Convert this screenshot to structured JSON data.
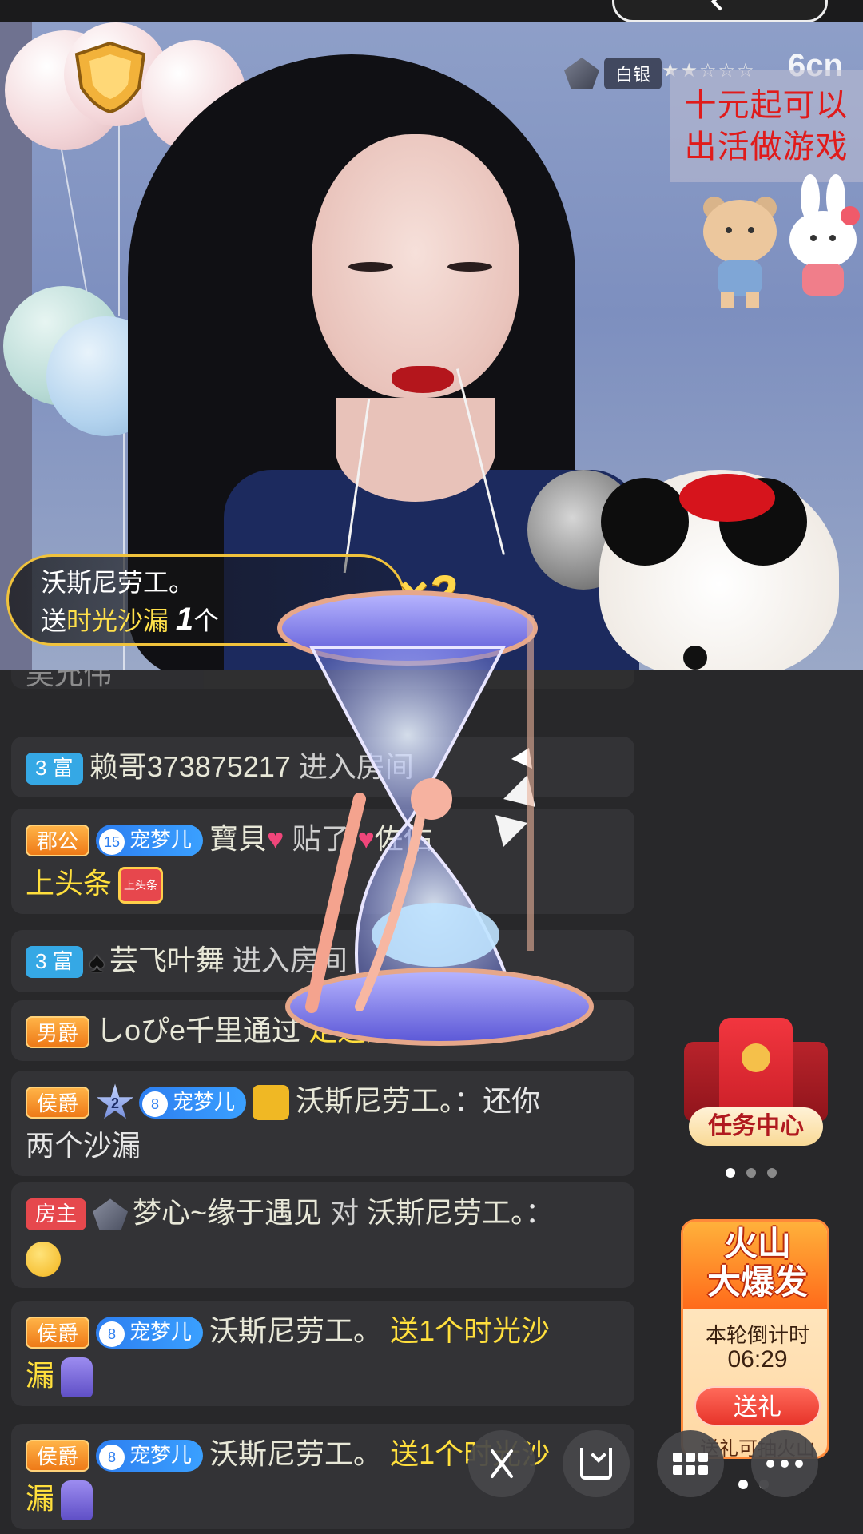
{
  "top": {
    "pill_label": ""
  },
  "video": {
    "level_badge": "白银",
    "level_stars": "★★☆☆☆",
    "logo": "6cn",
    "promo_lines": [
      "十元起可以",
      "出活做游戏"
    ]
  },
  "gift_notice": {
    "user": "沃斯尼劳工。",
    "prefix": "送",
    "gift_name": "时光沙漏",
    "count": "1",
    "unit": "个",
    "multiplier": "×2"
  },
  "chat": {
    "messages": [
      {
        "id": "m0",
        "text": "吴允伟"
      },
      {
        "id": "m1",
        "tag": "3 富",
        "name": "赖哥373875217",
        "action": "进入房间"
      },
      {
        "id": "m2",
        "tag": "郡公",
        "fan_level": "15",
        "fan_label": "宠梦儿",
        "name": "寶貝",
        "action": "贴了",
        "target": "佐佑",
        "line2": "上头条"
      },
      {
        "id": "m3",
        "tag": "3 富",
        "name": "芸飞叶舞",
        "action": "进入房间"
      },
      {
        "id": "m4",
        "tag": "男爵",
        "name": "しoぴe千里通过",
        "action": "足迹进入房间"
      },
      {
        "id": "m5",
        "tag": "侯爵",
        "star_level": "2",
        "fan_level": "8",
        "fan_label": "宠梦儿",
        "name": "沃斯尼劳工。",
        "colon": "：",
        "text": "还你",
        "line2": "两个沙漏"
      },
      {
        "id": "m6",
        "tag": "房主",
        "name": "梦心~缘于遇见",
        "mid": "对",
        "target": "沃斯尼劳工。",
        "colon": "："
      },
      {
        "id": "m7",
        "tag": "侯爵",
        "fan_level": "8",
        "fan_label": "宠梦儿",
        "name": "沃斯尼劳工。",
        "gift_text": "送1个时光沙",
        "line2": "漏"
      },
      {
        "id": "m8",
        "tag": "侯爵",
        "fan_level": "8",
        "fan_label": "宠梦儿",
        "name": "沃斯尼劳工。",
        "gift_text": "送1个时光沙",
        "line2": "漏"
      }
    ],
    "headline_badge": "上头条"
  },
  "task_center": {
    "label": "任务中心"
  },
  "volcano": {
    "title_line1": "火山",
    "title_line2": "大爆发",
    "countdown_label": "本轮倒计时",
    "countdown_value": "06:29",
    "send_button": "送礼",
    "note": "送礼可抽火山"
  },
  "colors": {
    "accent_yellow": "#ffdf3c",
    "tag_blue": "#35a8e5",
    "tag_orange": "#ee7a18",
    "tag_red": "#e6484d",
    "chat_bg": "#28282a"
  },
  "icons": [
    "guard-badge-icon",
    "level-emblem-icon",
    "spade-icon",
    "heart-icon",
    "star-level-icon",
    "avatar-icon",
    "emoji-face-icon",
    "sandglass-gift-icon",
    "red-envelope-icon",
    "share-icon",
    "download-icon",
    "grid-icon",
    "more-icon"
  ]
}
